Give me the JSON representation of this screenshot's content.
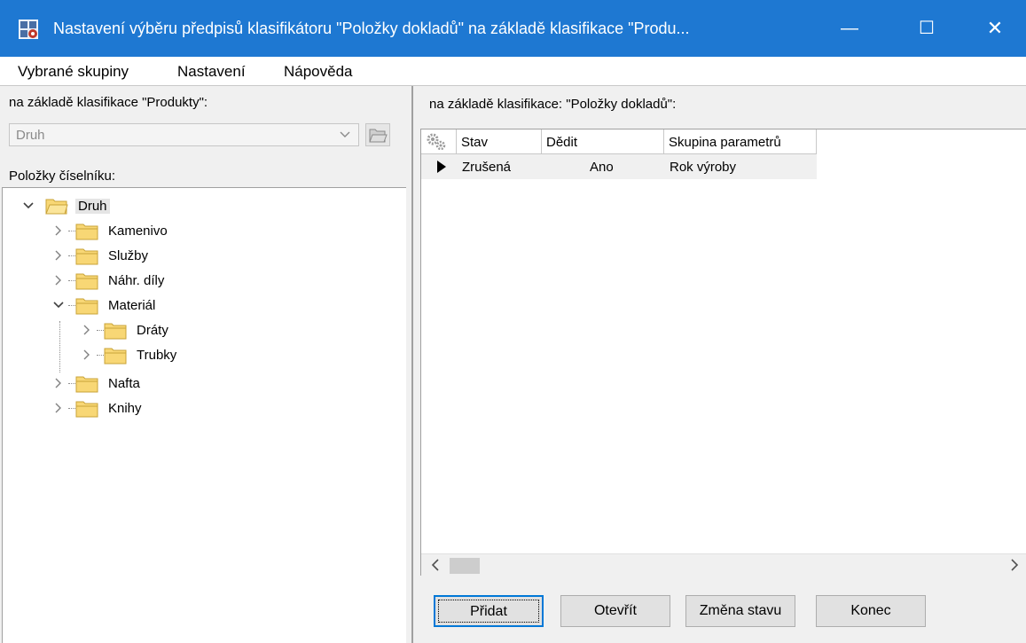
{
  "window": {
    "title": "Nastavení výběru předpisů klasifikátoru \"Položky dokladů\" na základě klasifikace \"Produ...",
    "minimize_glyph": "—",
    "maximize_glyph": "☐",
    "close_glyph": "✕"
  },
  "menu": {
    "items": [
      {
        "label": "Vybrané skupiny"
      },
      {
        "label": "Nastavení"
      },
      {
        "label": "Nápověda"
      }
    ]
  },
  "left": {
    "classification_label": "na základě klasifikace \"Produkty\":",
    "combo_value": "Druh",
    "items_label": "Položky číselníku:",
    "tree": [
      {
        "label": "Druh",
        "level": 0,
        "expanded": true,
        "selected": true
      },
      {
        "label": "Kamenivo",
        "level": 1,
        "expanded": false
      },
      {
        "label": "Služby",
        "level": 1,
        "expanded": false
      },
      {
        "label": "Náhr. díly",
        "level": 1,
        "expanded": false
      },
      {
        "label": "Materiál",
        "level": 1,
        "expanded": true
      },
      {
        "label": "Dráty",
        "level": 2,
        "expanded": false
      },
      {
        "label": "Trubky",
        "level": 2,
        "expanded": false
      },
      {
        "label": "Nafta",
        "level": 1,
        "expanded": false
      },
      {
        "label": "Knihy",
        "level": 1,
        "expanded": false
      }
    ]
  },
  "right": {
    "classification_label": "na základě klasifikace: \"Položky dokladů\":",
    "grid": {
      "columns": [
        "Stav",
        "Dědit",
        "Skupina parametrů"
      ],
      "rows": [
        {
          "stav": "Zrušená",
          "dedit": "Ano",
          "skupina": "Rok výroby"
        }
      ]
    },
    "buttons": {
      "pridat": "Přidat",
      "otevrit": "Otevřít",
      "zmena_stavu": "Změna stavu",
      "konec": "Konec"
    }
  },
  "colors": {
    "titlebar": "#1e78d2",
    "folder": "#f8d775",
    "focus": "#0078d7"
  }
}
